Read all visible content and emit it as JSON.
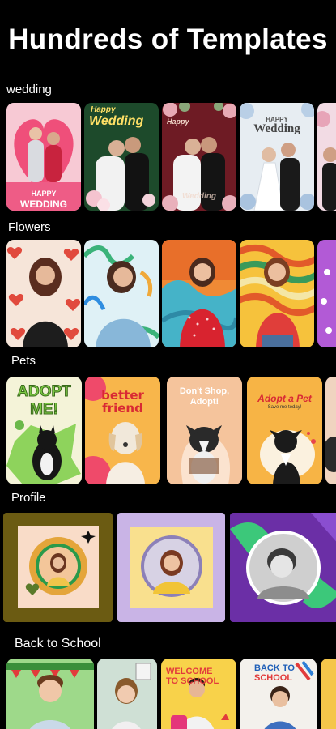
{
  "headline": "Hundreds of Templates",
  "sections": [
    {
      "label": "wedding",
      "cards": [
        {
          "caption_top": "HAPPY",
          "caption_bottom": "WEDDING"
        },
        {
          "caption_top": "Happy",
          "caption_bottom": "Wedding"
        },
        {
          "caption_top": "Happy",
          "caption_bottom": "Wedding"
        },
        {
          "caption_top": "HAPPY",
          "caption_bottom": "Wedding"
        },
        {
          "caption_top": "",
          "caption_bottom": ""
        }
      ]
    },
    {
      "label": "Flowers",
      "cards": [
        {},
        {},
        {},
        {},
        {}
      ]
    },
    {
      "label": "Pets",
      "cards": [
        {
          "caption_top": "ADOPT",
          "caption_bottom": "ME!"
        },
        {
          "caption_top": "better",
          "caption_bottom": "friend"
        },
        {
          "caption_top": "Don't Shop,",
          "caption_bottom": "Adopt!"
        },
        {
          "caption_top": "Adopt a Pet",
          "caption_bottom": "Save me today!"
        },
        {
          "caption_top": "",
          "caption_bottom": ""
        }
      ]
    },
    {
      "label": "Profile",
      "cards": [
        {},
        {},
        {}
      ]
    },
    {
      "label": "Back to School",
      "cards": [
        {
          "caption_top": "",
          "caption_bottom": ""
        },
        {
          "caption_top": "",
          "caption_bottom": ""
        },
        {
          "caption_top": "WELCOME",
          "caption_bottom": "TO SCHOOL"
        },
        {
          "caption_top": "BACK TO",
          "caption_bottom": "SCHOOL"
        },
        {
          "caption_top": "",
          "caption_bottom": ""
        }
      ]
    }
  ],
  "colors": {
    "background": "#000000",
    "text": "#ffffff"
  }
}
